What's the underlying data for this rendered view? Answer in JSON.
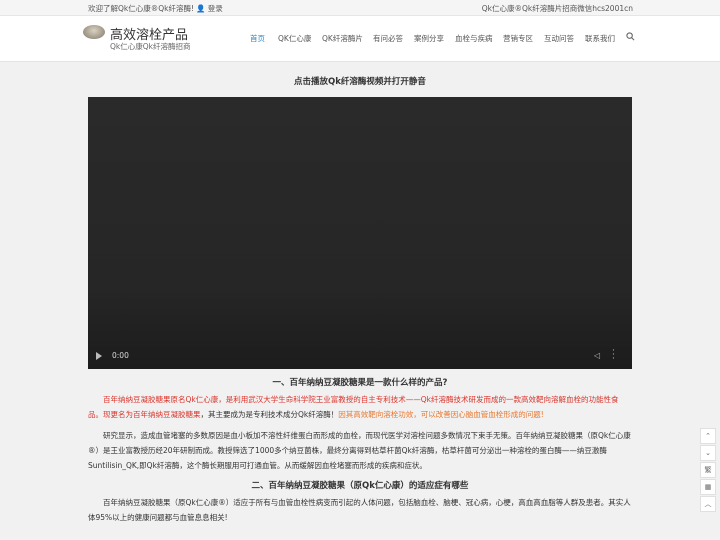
{
  "topbar": {
    "welcome": "欢迎了解Qk仁心康®Qk纤溶酶!",
    "login": "登录",
    "right": "Qk仁心康®Qk纤溶酶片招商微信hcs2001cn"
  },
  "header": {
    "brand": "高效溶栓产品",
    "tagline": "Qk仁心康Qk纤溶酶招商"
  },
  "nav": [
    "首页",
    "QK仁心康",
    "QK纤溶酶片",
    "有问必答",
    "案例分享",
    "血栓与疾病",
    "营销专区",
    "互动问答",
    "联系我们"
  ],
  "main": {
    "video_heading": "点击播放Qk纤溶酶视频并打开静音",
    "video_time": "0:00",
    "h1": "一、百年纳纳豆凝胶糖果是一款什么样的产品?",
    "p1_a": "百年纳纳豆凝胶糖果原名Qk仁心康，是利用武汉大学生命科学院王业富教授的自主专利技术——Qk纤溶酶技术研发而成的一款高效靶向溶解血栓的功能性食品。现更名为百年纳纳豆凝胶糖果",
    "p1_b": "，其主要成为是专利技术成分Qk纤溶酶！",
    "p1_c": "因其高效靶向溶栓功效，可以改善因心脑血管血栓形成的问题!",
    "p2": "研究显示，造成血管堵塞的多数原因是血小板加不溶性纤维蛋白而形成的血栓，而现代医学对溶栓问题多数情况下束手无策。百年纳纳豆凝胶糖果（原Qk仁心康®）是王业富教授历经20年研制而成。教授筛选了1000多个纳豆菌株，最终分离得到枯草杆菌Qk纤溶酶，枯草杆菌可分泌出一种溶栓的蛋白酶——纳豆激酶Suntilisin_QK,即Qk纤溶酶，这个酶长期服用可打通血管。从而缓解因血栓堵塞而形成的疾病和症状。",
    "h2": "二、百年纳纳豆凝胶糖果（原Qk仁心康）的适应症有哪些",
    "p3": "百年纳纳豆凝胶糖果（原Qk仁心康®）适应于所有与血管血栓性病变而引起的人体问题，包括脑血栓、脑梗、冠心病，心梗，高血高血脂等人群及患者。其实人体95%以上的健康问题都与血管息息相关!"
  },
  "sidebar": {
    "up": "⌃",
    "down": "⌄",
    "trad": "繁",
    "qr": "▦",
    "top": "︿"
  },
  "colors": {
    "accent": "#2a89c4",
    "red": "#d9342b",
    "orange": "#e8772e"
  }
}
